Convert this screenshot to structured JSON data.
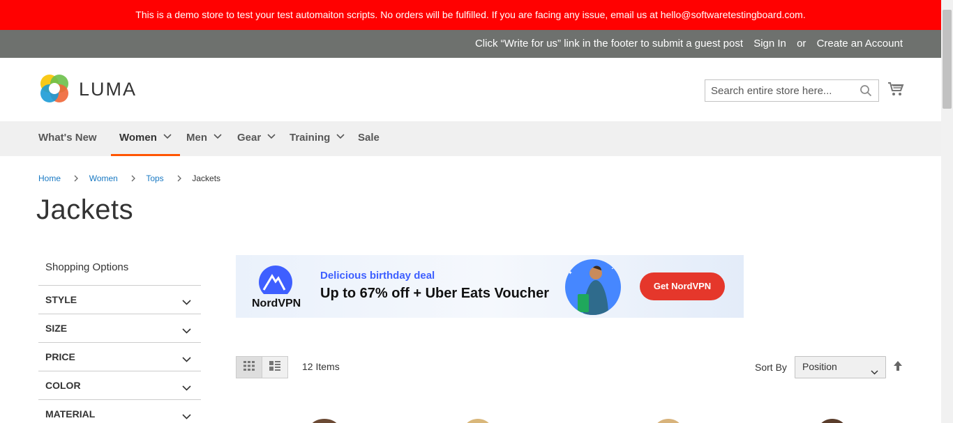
{
  "demo_notice": "This is a demo store to test your test automaiton scripts. No orders will be fulfilled. If you are facing any issue, email us at hello@softwaretestingboard.com.",
  "panel": {
    "guest_post": "Click “Write for us” link in the footer to submit a guest post",
    "sign_in": "Sign In",
    "or": "or",
    "create_account": "Create an Account"
  },
  "header": {
    "logo_text": "LUMA",
    "search_placeholder": "Search entire store here...",
    "search_value": ""
  },
  "nav": {
    "items": [
      {
        "label": "What's New",
        "has_dropdown": false,
        "active": false
      },
      {
        "label": "Women",
        "has_dropdown": true,
        "active": true
      },
      {
        "label": "Men",
        "has_dropdown": true,
        "active": false
      },
      {
        "label": "Gear",
        "has_dropdown": true,
        "active": false
      },
      {
        "label": "Training",
        "has_dropdown": true,
        "active": false
      },
      {
        "label": "Sale",
        "has_dropdown": false,
        "active": false
      }
    ]
  },
  "breadcrumbs": {
    "home": "Home",
    "women": "Women",
    "tops": "Tops",
    "current": "Jackets"
  },
  "page_title": "Jackets",
  "sidebar": {
    "title": "Shopping Options",
    "filters": [
      "STYLE",
      "SIZE",
      "PRICE",
      "COLOR",
      "MATERIAL"
    ]
  },
  "ad": {
    "brand": "NordVPN",
    "headline_small": "Delicious birthday deal",
    "headline_big": "Up to 67% off + Uber Eats Voucher",
    "cta": "Get NordVPN"
  },
  "toolbar": {
    "amount": "12 Items",
    "sort_label": "Sort By",
    "sort_selected": "Position"
  },
  "colors": {
    "demo_bar": "#ff0101",
    "panel_bar": "#6e716e",
    "nav_bg": "#f0f0f0",
    "nav_active_underline": "#ff5501",
    "link": "#1979c3",
    "ad_cta": "#e5372b",
    "ad_accent": "#3e5fff"
  }
}
